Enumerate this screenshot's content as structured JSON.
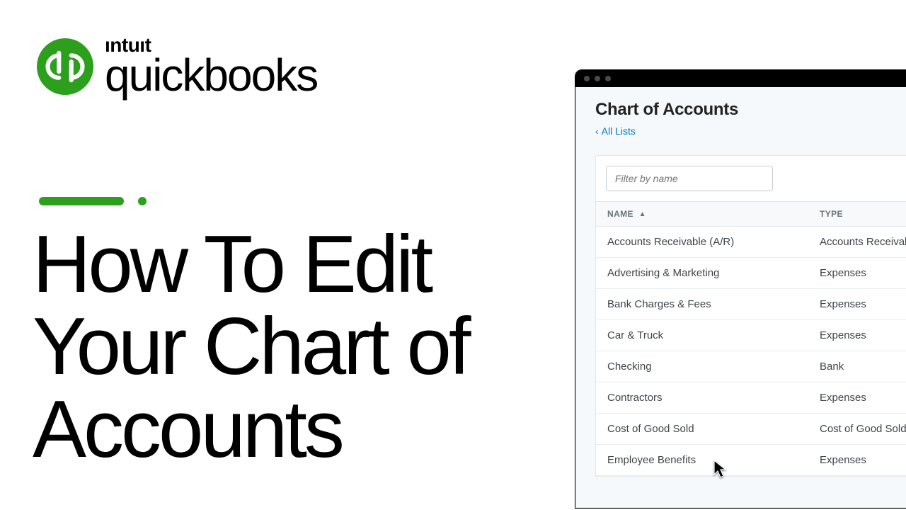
{
  "brand": {
    "company": "ıntuıt",
    "product": "quickbooks"
  },
  "headline": "How To Edit\nYour Chart of\nAccounts",
  "appwindow": {
    "title": "Chart of Accounts",
    "breadcrumb_label": "All Lists",
    "filter_placeholder": "Filter by name",
    "columns": {
      "name": "NAME",
      "type": "TYPE"
    },
    "rows": [
      {
        "name": "Accounts Receivable (A/R)",
        "type": "Accounts Receivable"
      },
      {
        "name": "Advertising & Marketing",
        "type": "Expenses"
      },
      {
        "name": "Bank Charges & Fees",
        "type": "Expenses"
      },
      {
        "name": "Car & Truck",
        "type": "Expenses"
      },
      {
        "name": "Checking",
        "type": "Bank"
      },
      {
        "name": "Contractors",
        "type": "Expenses"
      },
      {
        "name": "Cost of Good Sold",
        "type": "Cost of Good Sold"
      },
      {
        "name": "Employee Benefits",
        "type": "Expenses"
      }
    ]
  }
}
